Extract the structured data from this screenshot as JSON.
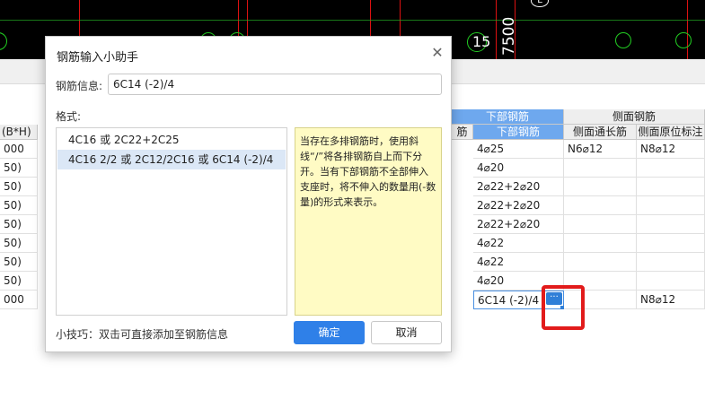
{
  "cad": {
    "label_15": "15",
    "label_7500": "7500",
    "badge": "L"
  },
  "table": {
    "header_top": {
      "lower_rebar": "下部钢筋",
      "side_rebar": "侧面钢筋"
    },
    "header_sub": {
      "left_partial": "(B*H)",
      "mid_partial": "筋",
      "lower_rebar": "下部钢筋",
      "side_long": "侧面通长筋",
      "side_orig": "侧面原位标注"
    },
    "rows": [
      {
        "c0": "000",
        "lower": "4⌀25",
        "side_long": "N6⌀12",
        "side_orig": "N8⌀12"
      },
      {
        "c0": "50)",
        "lower": "4⌀20",
        "side_long": "",
        "side_orig": ""
      },
      {
        "c0": "50)",
        "lower": "2⌀22+2⌀20",
        "side_long": "",
        "side_orig": ""
      },
      {
        "c0": "50)",
        "lower": "2⌀22+2⌀20",
        "side_long": "",
        "side_orig": ""
      },
      {
        "c0": "50)",
        "lower": "2⌀22+2⌀20",
        "side_long": "",
        "side_orig": ""
      },
      {
        "c0": "50)",
        "lower": "4⌀22",
        "side_long": "",
        "side_orig": ""
      },
      {
        "c0": "50)",
        "lower": "4⌀22",
        "side_long": "",
        "side_orig": ""
      },
      {
        "c0": "50)",
        "lower": "4⌀20",
        "side_long": "",
        "side_orig": ""
      },
      {
        "c0": "000",
        "lower": "6C14 (-2)/4",
        "side_long": "",
        "side_orig": "N8⌀12"
      }
    ],
    "ellipsis": "···"
  },
  "dialog": {
    "title": "钢筋输入小助手",
    "close_glyph": "✕",
    "info_label": "钢筋信息:",
    "info_value": "6C14 (-2)/4",
    "format_label": "格式:",
    "format_options": [
      "4C16 或 2C22+2C25",
      "4C16 2/2 或 2C12/2C16 或 6C14 (-2)/4"
    ],
    "selected_index": 1,
    "help_text": "当存在多排钢筋时，使用斜线“/”将各排钢筋自上而下分开。当有下部钢筋不全部伸入支座时，将不伸入的数量用(-数量)的形式来表示。",
    "tip": "小技巧：双击可直接添加至钢筋信息",
    "ok_label": "确定",
    "cancel_label": "取消"
  }
}
